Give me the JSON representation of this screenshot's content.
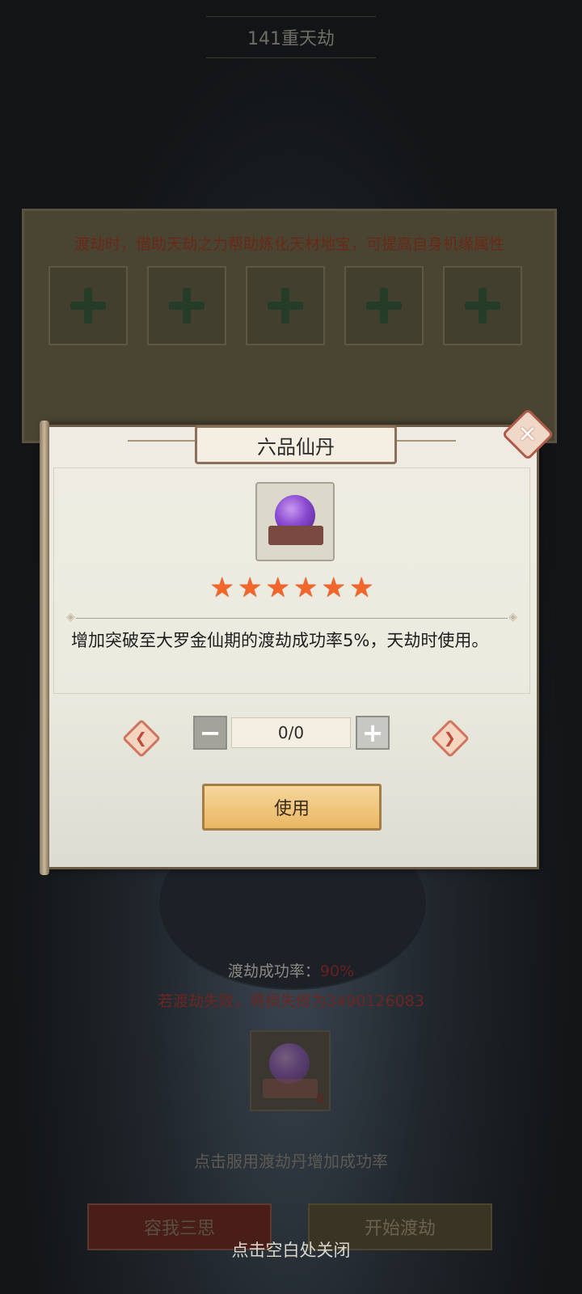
{
  "header": {
    "title": "141重天劫"
  },
  "refine_panel": {
    "description": "渡劫时，借助天劫之力帮助炼化天材地宝，可提高自身机缘属性",
    "slots": [
      "add",
      "add",
      "add",
      "add",
      "add"
    ]
  },
  "tribulation": {
    "rate_label": "渡劫成功率：",
    "rate_value": "90%",
    "fail_text": "若渡劫失败，将损失修为3490126083",
    "pill_count": "0",
    "hint": "点击服用渡劫丹增加成功率",
    "cancel_label": "容我三思",
    "start_label": "开始渡劫",
    "close_hint": "点击空白处关闭"
  },
  "modal": {
    "title": "六品仙丹",
    "stars": 6,
    "star_glyph": "★",
    "description": "增加突破至大罗金仙期的渡劫成功率5%，天劫时使用。",
    "count": "0/0",
    "minus_label": "−",
    "plus_label": "+",
    "use_label": "使用",
    "close_label": "✕",
    "left_arrow": "❮",
    "right_arrow": "❯"
  },
  "colors": {
    "star": "#f2662a",
    "use_button": "#eab764",
    "close_accent": "#b05a4a"
  }
}
